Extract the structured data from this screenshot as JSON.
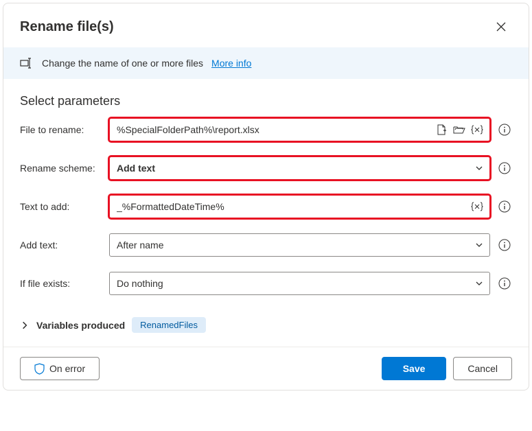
{
  "dialog": {
    "title": "Rename file(s)",
    "info_text": "Change the name of one or more files",
    "more_info": "More info",
    "section_title": "Select parameters"
  },
  "fields": {
    "file_to_rename": {
      "label": "File to rename:",
      "value": "%SpecialFolderPath%\\report.xlsx"
    },
    "rename_scheme": {
      "label": "Rename scheme:",
      "value": "Add text"
    },
    "text_to_add": {
      "label": "Text to add:",
      "value": "_%FormattedDateTime%"
    },
    "add_text": {
      "label": "Add text:",
      "value": "After name"
    },
    "if_file_exists": {
      "label": "If file exists:",
      "value": "Do nothing"
    }
  },
  "variables": {
    "label": "Variables produced",
    "chip": "RenamedFiles"
  },
  "buttons": {
    "on_error": "On error",
    "save": "Save",
    "cancel": "Cancel"
  }
}
